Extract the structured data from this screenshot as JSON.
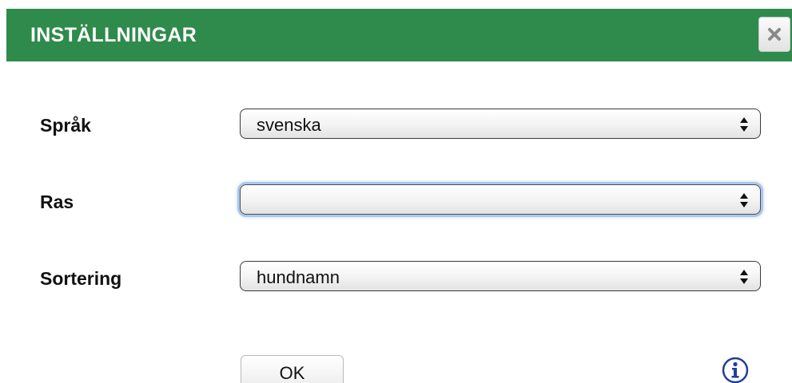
{
  "dialog": {
    "title": "INSTÄLLNINGAR",
    "close_icon": "close-x-icon",
    "header_color": "#2e8b4b"
  },
  "fields": [
    {
      "label": "Språk",
      "value": "svenska",
      "focused": false
    },
    {
      "label": "Ras",
      "value": "",
      "focused": true
    },
    {
      "label": "Sortering",
      "value": "hundnamn",
      "focused": false
    }
  ],
  "actions": {
    "ok_label": "OK",
    "info_icon": "info-icon"
  }
}
